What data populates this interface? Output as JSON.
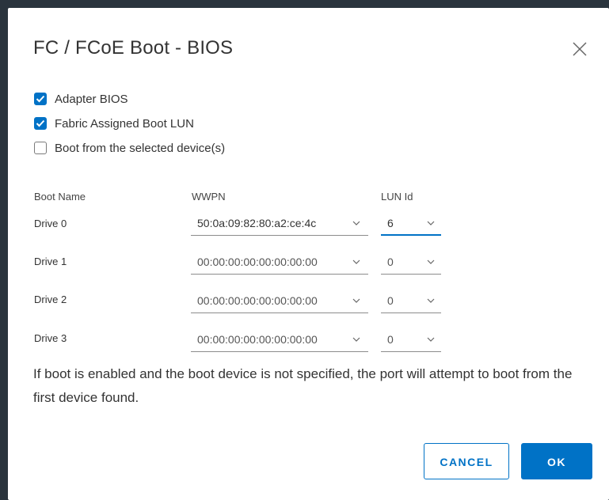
{
  "dialog": {
    "title": "FC / FCoE Boot - BIOS",
    "close_icon": "close-icon"
  },
  "options": [
    {
      "label": "Adapter BIOS",
      "checked": true
    },
    {
      "label": "Fabric Assigned Boot LUN",
      "checked": true
    },
    {
      "label": "Boot from the selected device(s)",
      "checked": false
    }
  ],
  "table": {
    "headers": {
      "boot_name": "Boot Name",
      "wwpn": "WWPN",
      "lun_id": "LUN Id"
    },
    "rows": [
      {
        "name": "Drive 0",
        "wwpn": "50:0a:09:82:80:a2:ce:4c",
        "lun": "6"
      },
      {
        "name": "Drive 1",
        "wwpn": "00:00:00:00:00:00:00:00",
        "lun": "0"
      },
      {
        "name": "Drive 2",
        "wwpn": "00:00:00:00:00:00:00:00",
        "lun": "0"
      },
      {
        "name": "Drive 3",
        "wwpn": "00:00:00:00:00:00:00:00",
        "lun": "0"
      }
    ]
  },
  "info_text": "If boot is enabled and the boot device is not specified, the port will attempt to boot from the first device found.",
  "buttons": {
    "cancel_label": "CANCEL",
    "ok_label": "OK"
  },
  "colors": {
    "accent": "#0072c6",
    "text": "#333333",
    "backdrop": "#1f2933"
  }
}
